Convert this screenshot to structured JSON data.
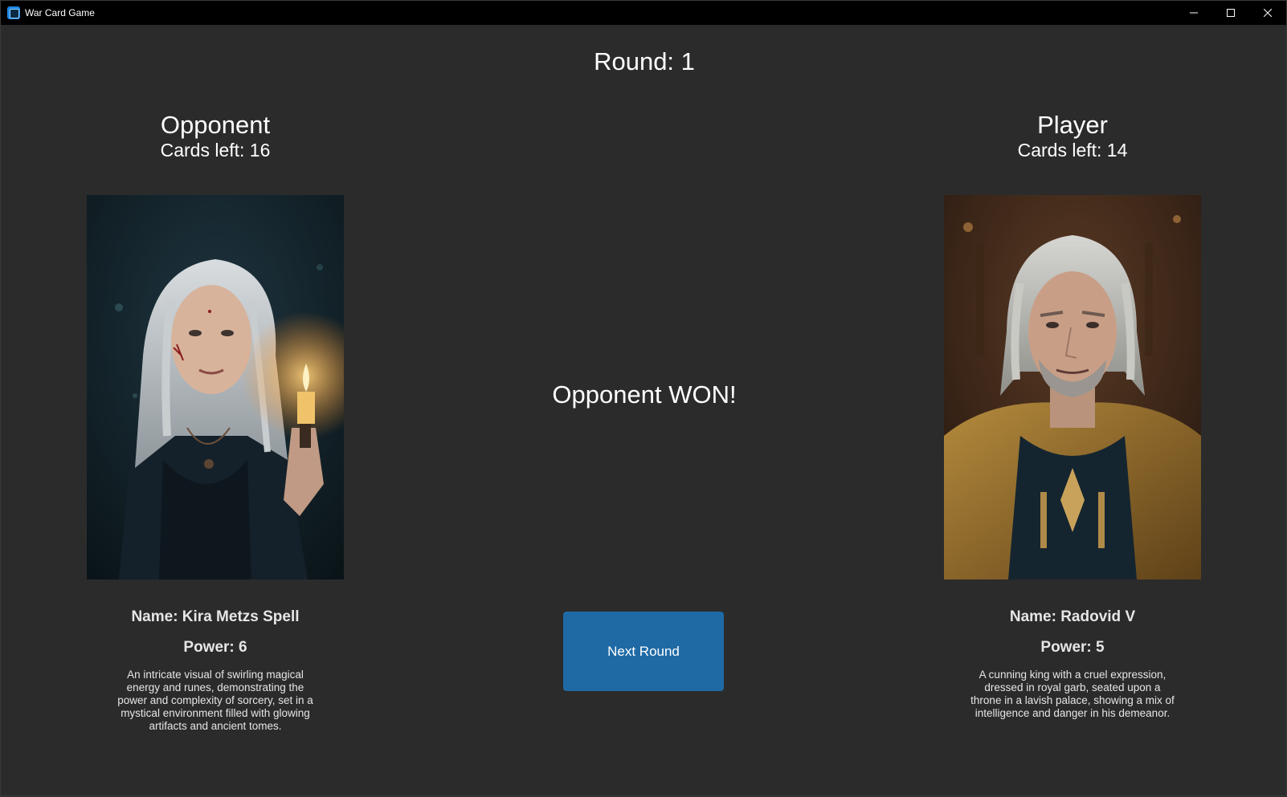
{
  "window": {
    "title": "War Card Game",
    "icon": "app-icon",
    "controls": [
      "minimize-icon",
      "maximize-icon",
      "close-icon"
    ]
  },
  "game": {
    "round_label": "Round: 1",
    "result": "Opponent WON!",
    "next_button_label": "Next Round",
    "accent_color": "#1f6aa5",
    "background_color": "#2b2b2b"
  },
  "opponent": {
    "title": "Opponent",
    "cards_left": "Cards left: 16",
    "card": {
      "name": "Name: Kira Metzs Spell",
      "power": "Power: 6",
      "description": "An intricate visual of swirling magical energy and runes, demonstrating the power and complexity of sorcery, set in a mystical environment filled with glowing artifacts and ancient tomes."
    }
  },
  "player": {
    "title": "Player",
    "cards_left": "Cards left: 14",
    "card": {
      "name": "Name: Radovid V",
      "power": "Power: 5",
      "description": "A cunning king with a cruel expression, dressed in royal garb, seated upon a throne in a lavish palace, showing a mix of intelligence and danger in his demeanor."
    }
  }
}
